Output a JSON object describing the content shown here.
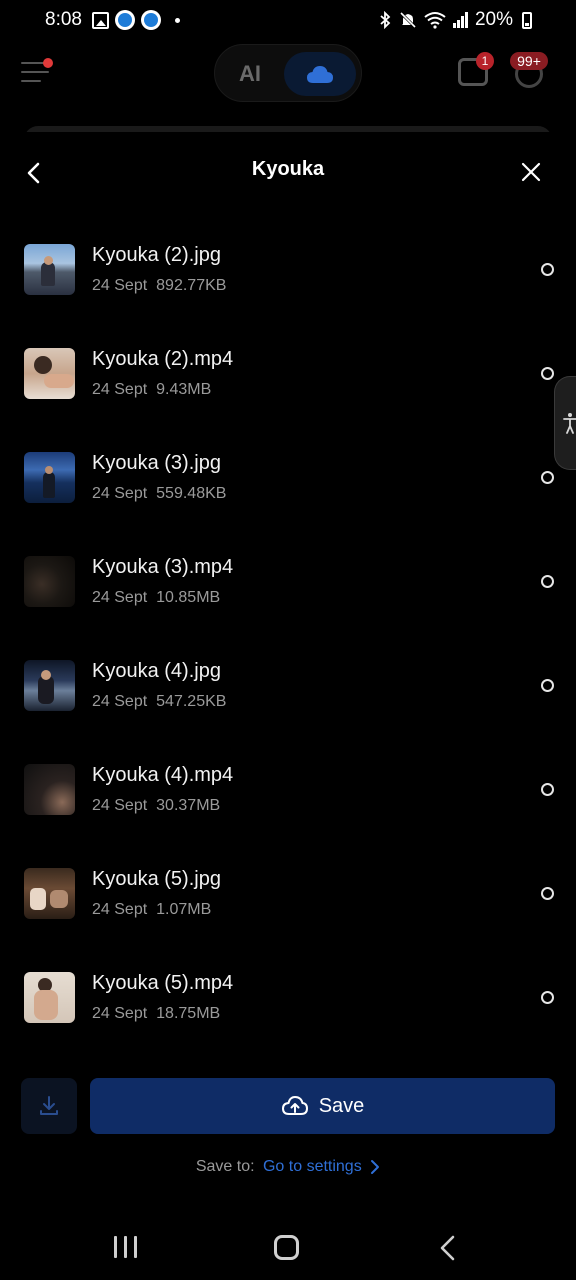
{
  "status_bar": {
    "time": "8:08",
    "battery": "20%",
    "icons_left": [
      "gallery-icon",
      "app-icon",
      "app-icon",
      "dot"
    ],
    "icons_right": [
      "bluetooth-icon",
      "mute-icon",
      "wifi-icon",
      "signal-icon",
      "battery-icon"
    ]
  },
  "header": {
    "mode_ai": "AI",
    "message_badge": "1",
    "notification_badge": "99+"
  },
  "sheet": {
    "title": "Kyouka"
  },
  "files": [
    {
      "name": "Kyouka (2).jpg",
      "date": "24 Sept",
      "size": "892.77KB",
      "selected": false
    },
    {
      "name": "Kyouka (2).mp4",
      "date": "24 Sept",
      "size": "9.43MB",
      "selected": false
    },
    {
      "name": "Kyouka (3).jpg",
      "date": "24 Sept",
      "size": "559.48KB",
      "selected": false
    },
    {
      "name": "Kyouka (3).mp4",
      "date": "24 Sept",
      "size": "10.85MB",
      "selected": false
    },
    {
      "name": "Kyouka (4).jpg",
      "date": "24 Sept",
      "size": "547.25KB",
      "selected": false
    },
    {
      "name": "Kyouka (4).mp4",
      "date": "24 Sept",
      "size": "30.37MB",
      "selected": false
    },
    {
      "name": "Kyouka (5).jpg",
      "date": "24 Sept",
      "size": "1.07MB",
      "selected": false
    },
    {
      "name": "Kyouka (5).mp4",
      "date": "24 Sept",
      "size": "18.75MB",
      "selected": false
    }
  ],
  "actions": {
    "save_label": "Save",
    "save_to_label": "Save to:",
    "save_to_link": "Go to settings"
  },
  "colors": {
    "accent_blue": "#2f6fd6",
    "save_button": "#0f2c66",
    "background": "#000000"
  }
}
